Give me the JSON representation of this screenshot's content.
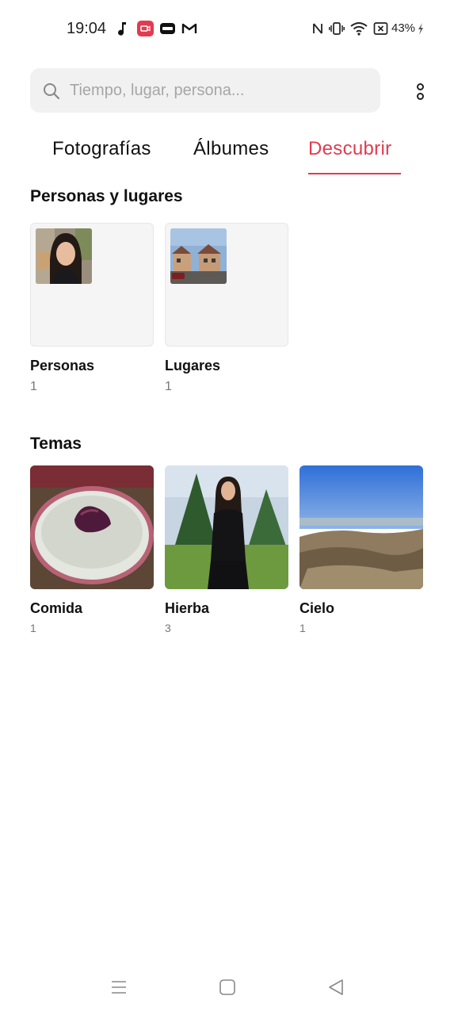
{
  "status_bar": {
    "time": "19:04",
    "battery": "43%",
    "icons": [
      "music-note-icon",
      "screen-record-icon",
      "wallet-icon",
      "gmail-icon",
      "nfc-icon",
      "vibrate-icon",
      "wifi-icon",
      "sim-icon",
      "charging-icon"
    ]
  },
  "search": {
    "placeholder": "Tiempo, lugar, persona..."
  },
  "tabs": [
    {
      "label": "Fotografías",
      "active": false
    },
    {
      "label": "Álbumes",
      "active": false
    },
    {
      "label": "Descubrir",
      "active": true
    }
  ],
  "people_places": {
    "title": "Personas y lugares",
    "items": [
      {
        "label": "Personas",
        "count": "1"
      },
      {
        "label": "Lugares",
        "count": "1"
      }
    ]
  },
  "topics": {
    "title": "Temas",
    "items": [
      {
        "label": "Comida",
        "count": "1"
      },
      {
        "label": "Hierba",
        "count": "3"
      },
      {
        "label": "Cielo",
        "count": "1"
      }
    ]
  },
  "colors": {
    "accent": "#e23b4f",
    "background": "#ffffff",
    "search_bg": "#f1f1f1"
  }
}
